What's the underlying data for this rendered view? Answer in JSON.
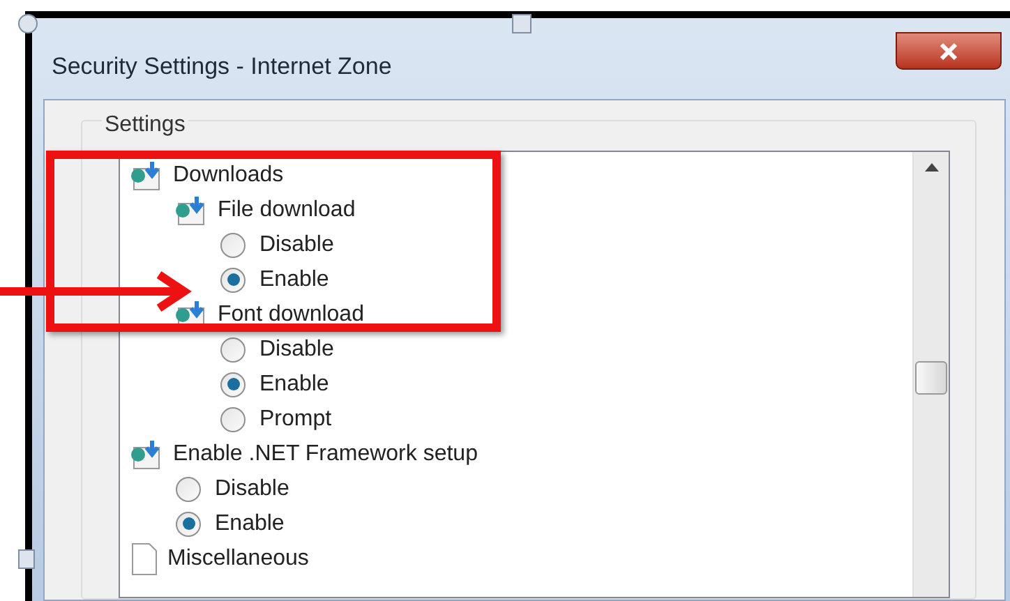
{
  "window": {
    "title": "Security Settings - Internet Zone"
  },
  "settings": {
    "label": "Settings",
    "items": [
      {
        "kind": "download",
        "label": "Downloads",
        "children": [
          {
            "kind": "download",
            "label": "File download",
            "children": [
              {
                "kind": "option",
                "label": "Disable",
                "selected": false
              },
              {
                "kind": "option",
                "label": "Enable",
                "selected": true
              }
            ]
          },
          {
            "kind": "download",
            "label": "Font download",
            "children": [
              {
                "kind": "option",
                "label": "Disable",
                "selected": false
              },
              {
                "kind": "option",
                "label": "Enable",
                "selected": true
              },
              {
                "kind": "option",
                "label": "Prompt",
                "selected": false
              }
            ]
          }
        ]
      },
      {
        "kind": "download",
        "label": "Enable .NET Framework setup",
        "children": [
          {
            "kind": "option",
            "label": "Disable",
            "selected": false
          },
          {
            "kind": "option",
            "label": "Enable",
            "selected": true
          }
        ]
      },
      {
        "kind": "page",
        "label": "Miscellaneous"
      }
    ]
  }
}
